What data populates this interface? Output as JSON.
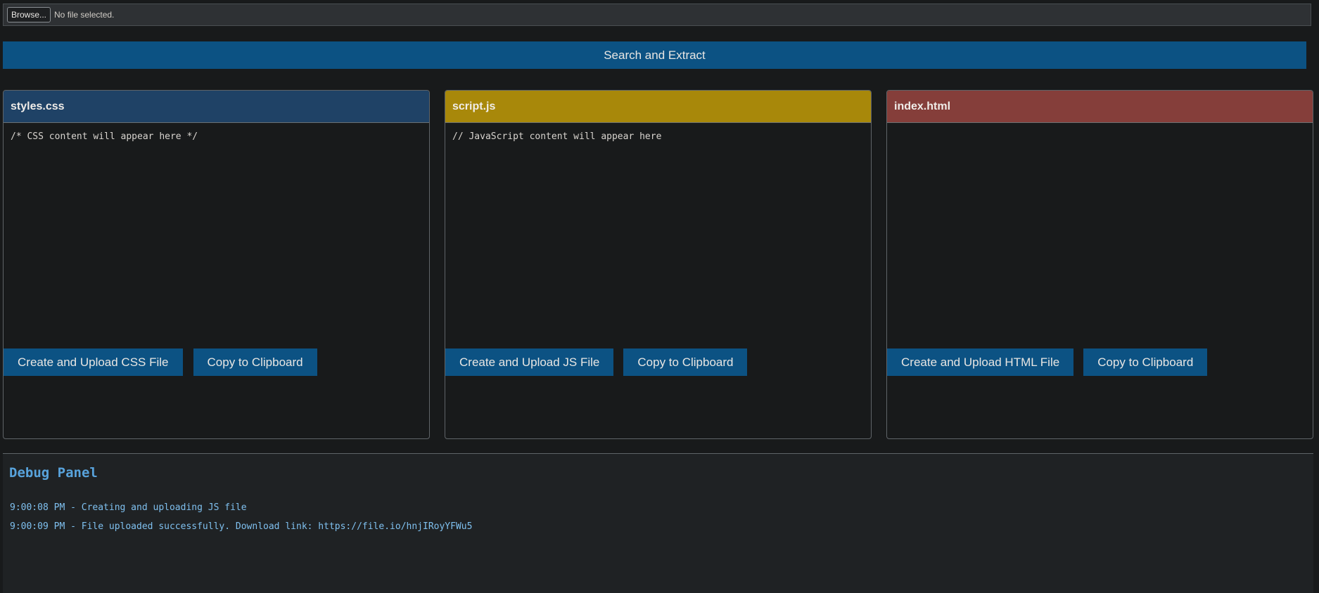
{
  "file_input": {
    "browse_label": "Browse...",
    "status_text": "No file selected."
  },
  "search_button_label": "Search and Extract",
  "panels": [
    {
      "title": "styles.css",
      "header_color": "#1f4266",
      "content": "/* CSS content will appear here */",
      "upload_label": "Create and Upload CSS File",
      "copy_label": "Copy to Clipboard"
    },
    {
      "title": "script.js",
      "header_color": "#a8880a",
      "content": "// JavaScript content will appear here",
      "upload_label": "Create and Upload JS File",
      "copy_label": "Copy to Clipboard"
    },
    {
      "title": "index.html",
      "header_color": "#853e3a",
      "content": "",
      "upload_label": "Create and Upload HTML File",
      "copy_label": "Copy to Clipboard"
    }
  ],
  "debug": {
    "title": "Debug Panel",
    "logs": [
      "9:00:08 PM - Creating and uploading JS file",
      "9:00:09 PM - File uploaded successfully. Download link: https://file.io/hnjIRoyYFWu5"
    ]
  },
  "colors": {
    "accent_button": "#0c5283",
    "debug_text": "#7fc0ef",
    "debug_title": "#58a3dc"
  }
}
